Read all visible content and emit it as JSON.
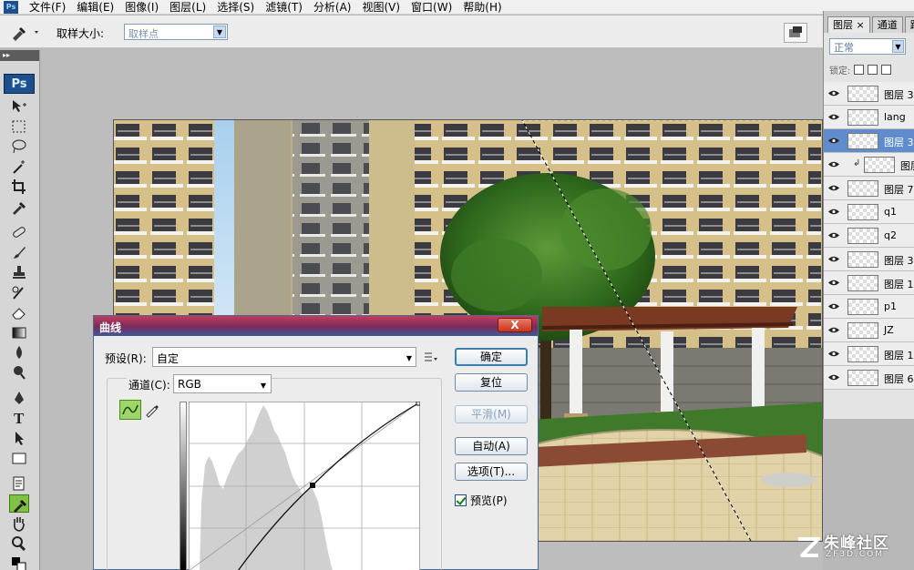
{
  "menubar": {
    "app_icon": "Ps",
    "items": [
      "文件(F)",
      "编辑(E)",
      "图像(I)",
      "图层(L)",
      "选择(S)",
      "滤镜(T)",
      "分析(A)",
      "视图(V)",
      "窗口(W)",
      "帮助(H)"
    ]
  },
  "options": {
    "sample_size_label": "取样大小:",
    "sample_size_value": "取样点"
  },
  "toolbox": {
    "logo": "Ps",
    "tools": [
      "move-icon",
      "marquee-icon",
      "lasso-icon",
      "magic-wand-icon",
      "crop-icon",
      "eyedropper-icon",
      "healing-brush-icon",
      "brush-icon",
      "clone-stamp-icon",
      "history-brush-icon",
      "eraser-icon",
      "gradient-icon",
      "blur-icon",
      "dodge-icon",
      "pen-icon",
      "type-icon",
      "path-select-icon",
      "shape-icon",
      "notes-icon",
      "color-sampler-icon",
      "hand-icon",
      "zoom-icon"
    ],
    "active_tool": "color-sampler-icon"
  },
  "layers_panel": {
    "tabs": [
      "图层 ×",
      "通道",
      "路"
    ],
    "blend_mode": "正常",
    "lock_label": "锁定:",
    "layers": [
      {
        "name": "图层 3",
        "visible": true,
        "selected": false,
        "clipped": false
      },
      {
        "name": "lang",
        "visible": true,
        "selected": false,
        "clipped": false
      },
      {
        "name": "图层 3",
        "visible": true,
        "selected": true,
        "clipped": false
      },
      {
        "name": "图层",
        "visible": true,
        "selected": false,
        "clipped": true
      },
      {
        "name": "图层 7",
        "visible": true,
        "selected": false,
        "clipped": false
      },
      {
        "name": "q1",
        "visible": true,
        "selected": false,
        "clipped": false
      },
      {
        "name": "q2",
        "visible": true,
        "selected": false,
        "clipped": false
      },
      {
        "name": "图层 3",
        "visible": true,
        "selected": false,
        "clipped": false
      },
      {
        "name": "图层 1",
        "visible": true,
        "selected": false,
        "clipped": false
      },
      {
        "name": "p1",
        "visible": true,
        "selected": false,
        "clipped": false
      },
      {
        "name": "JZ",
        "visible": true,
        "selected": false,
        "clipped": false
      },
      {
        "name": "图层 1",
        "visible": true,
        "selected": false,
        "clipped": false
      },
      {
        "name": "图层 6",
        "visible": true,
        "selected": false,
        "clipped": false
      }
    ]
  },
  "curves_dialog": {
    "title": "曲线",
    "close": "X",
    "preset_label": "预设(R):",
    "preset_value": "自定",
    "channel_label": "通道(C):",
    "channel_value": "RGB",
    "buttons": {
      "ok": "确定",
      "reset": "复位",
      "smooth": "平滑(M)",
      "auto": "自动(A)",
      "options": "选项(T)..."
    },
    "preview_label": "预览(P)",
    "preview_checked": true
  },
  "watermark": {
    "main": "朱峰社区",
    "sub": "ZF3D.COM"
  },
  "colors": {
    "selected_layer": "#5f8ccd",
    "active_tool": "#7fc241",
    "dialog_title_start": "#c23d5a",
    "dialog_title_end": "#3c5a98"
  }
}
